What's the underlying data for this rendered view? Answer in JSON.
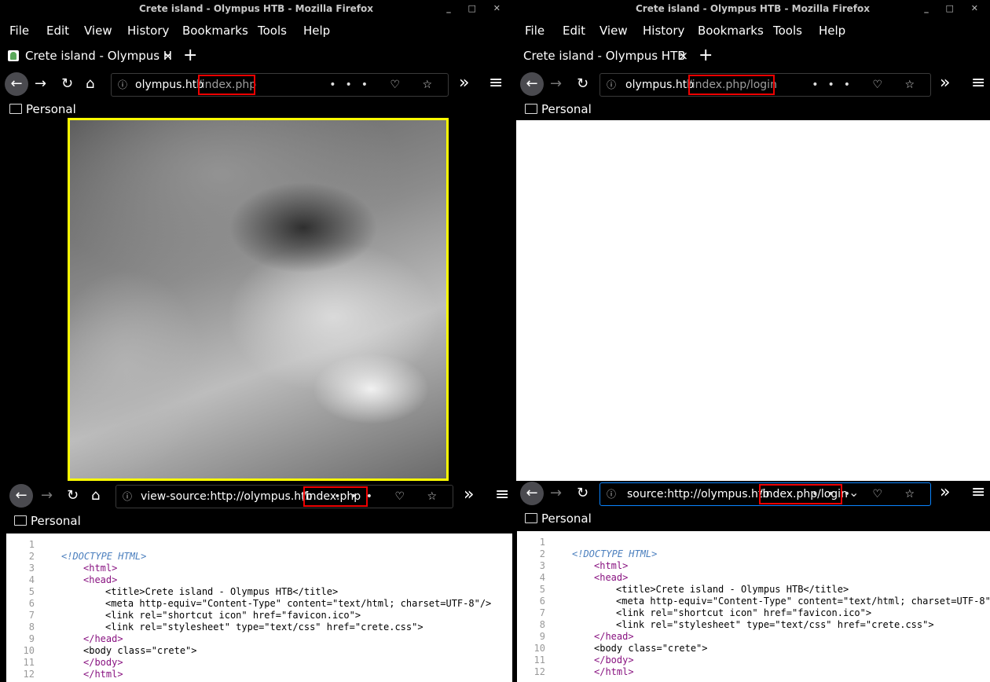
{
  "window_title": "Crete island - Olympus HTB - Mozilla Firefox",
  "window_buttons": "_ □ ✕",
  "menu": [
    "File",
    "Edit",
    "View",
    "History",
    "Bookmarks",
    "Tools",
    "Help"
  ],
  "tab_left": "Crete island - Olympus H",
  "tab_right": "Crete island - Olympus HTB",
  "tab_close": "×",
  "new_tab": "+",
  "bookmark_folder": "Personal",
  "url_info_icon": "ⓘ",
  "url_actions": "••• ♡ ☆",
  "overflow_icon": "»",
  "hamburger_icon": "≡",
  "top_left": {
    "host": "olympus.htb",
    "path": "/index.php"
  },
  "top_right": {
    "host": "olympus.htb",
    "path": "/index.php/login"
  },
  "bottom_left": {
    "host": "view-source:http://olympus.htb",
    "path": "/index.php"
  },
  "bottom_right": {
    "host": "source:http://olympus.htb",
    "path": "/index.php/login",
    "dropdown": "⌄"
  },
  "source_lines": [
    {
      "n": "1",
      "text": ""
    },
    {
      "n": "2",
      "text": "<!DOCTYPE HTML>"
    },
    {
      "n": "3",
      "text": "<html>"
    },
    {
      "n": "4",
      "text": "<head>"
    },
    {
      "n": "5",
      "text": "<title>Crete island - Olympus HTB</title>"
    },
    {
      "n": "6",
      "text": "<meta http-equiv=\"Content-Type\" content=\"text/html; charset=UTF-8\"/>"
    },
    {
      "n": "7",
      "text": "<link rel=\"shortcut icon\" href=\"favicon.ico\">"
    },
    {
      "n": "8",
      "text": "<link rel=\"stylesheet\" type=\"text/css\" href=\"crete.css\">"
    },
    {
      "n": "9",
      "text": "</head>"
    },
    {
      "n": "10",
      "text": "<body class=\"crete\">"
    },
    {
      "n": "11",
      "text": "</body>"
    },
    {
      "n": "12",
      "text": "</html>"
    }
  ],
  "colors": {
    "highlight_box": "#e00000",
    "image_border": "#ffff00",
    "focus_ring": "#0a84ff"
  }
}
